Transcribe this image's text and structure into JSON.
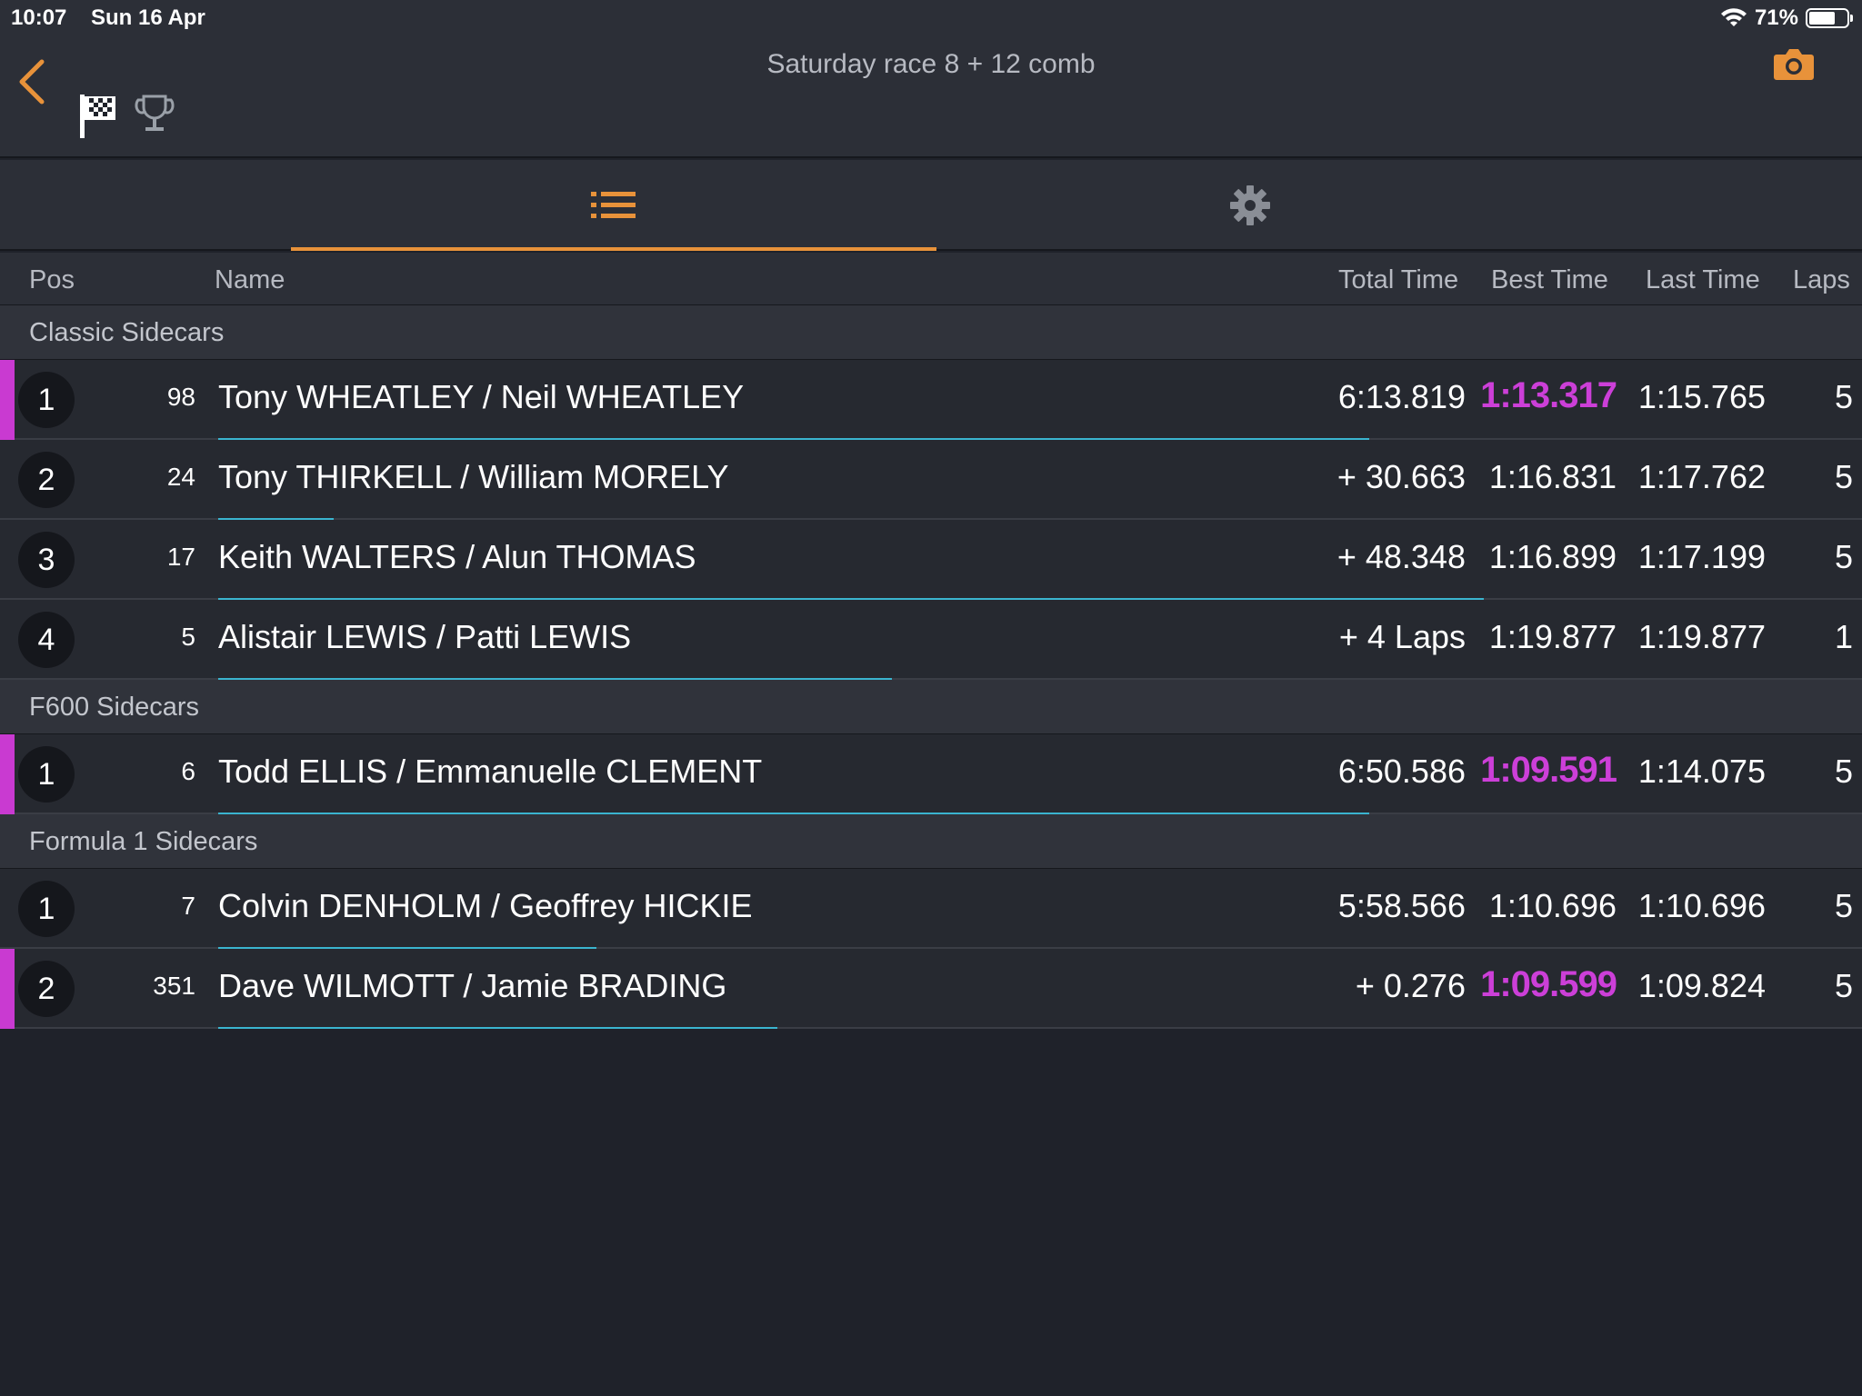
{
  "status_bar": {
    "time": "10:07",
    "date": "Sun 16 Apr",
    "battery": "71%",
    "battery_level": 0.71
  },
  "header": {
    "title": "Saturday race 8 + 12 comb"
  },
  "columns": {
    "pos": "Pos",
    "name": "Name",
    "total": "Total Time",
    "best": "Best Time",
    "last": "Last Time",
    "laps": "Laps"
  },
  "colors": {
    "accent": "#e8923a",
    "fastest": "#cc3fd8",
    "progress": "#3ab4cf"
  },
  "groups": [
    {
      "title": "Classic Sidecars",
      "rows": [
        {
          "pos": "1",
          "num": "98",
          "name": "Tony WHEATLEY / Neil WHEATLEY",
          "total": "6:13.819",
          "best": "1:13.317",
          "last": "1:15.765",
          "laps": "5",
          "fastest": true,
          "highlight": true,
          "progress": 0.7
        },
        {
          "pos": "2",
          "num": "24",
          "name": "Tony THIRKELL / William MORELY",
          "total": "+ 30.663",
          "best": "1:16.831",
          "last": "1:17.762",
          "laps": "5",
          "fastest": false,
          "highlight": false,
          "progress": 0.07
        },
        {
          "pos": "3",
          "num": "17",
          "name": "Keith WALTERS / Alun THOMAS",
          "total": "+ 48.348",
          "best": "1:16.899",
          "last": "1:17.199",
          "laps": "5",
          "fastest": false,
          "highlight": false,
          "progress": 0.77
        },
        {
          "pos": "4",
          "num": "5",
          "name": "Alistair LEWIS / Patti LEWIS",
          "total": "+ 4 Laps",
          "best": "1:19.877",
          "last": "1:19.877",
          "laps": "1",
          "fastest": false,
          "highlight": false,
          "progress": 0.41
        }
      ]
    },
    {
      "title": "F600 Sidecars",
      "rows": [
        {
          "pos": "1",
          "num": "6",
          "name": "Todd ELLIS / Emmanuelle CLEMENT",
          "total": "6:50.586",
          "best": "1:09.591",
          "last": "1:14.075",
          "laps": "5",
          "fastest": true,
          "highlight": true,
          "progress": 0.7
        }
      ]
    },
    {
      "title": "Formula 1 Sidecars",
      "rows": [
        {
          "pos": "1",
          "num": "7",
          "name": "Colvin DENHOLM / Geoffrey HICKIE",
          "total": "5:58.566",
          "best": "1:10.696",
          "last": "1:10.696",
          "laps": "5",
          "fastest": false,
          "highlight": false,
          "progress": 0.23
        },
        {
          "pos": "2",
          "num": "351",
          "name": "Dave WILMOTT / Jamie BRADING",
          "total": "+ 0.276",
          "best": "1:09.599",
          "last": "1:09.824",
          "laps": "5",
          "fastest": true,
          "highlight": true,
          "progress": 0.34
        }
      ]
    }
  ]
}
